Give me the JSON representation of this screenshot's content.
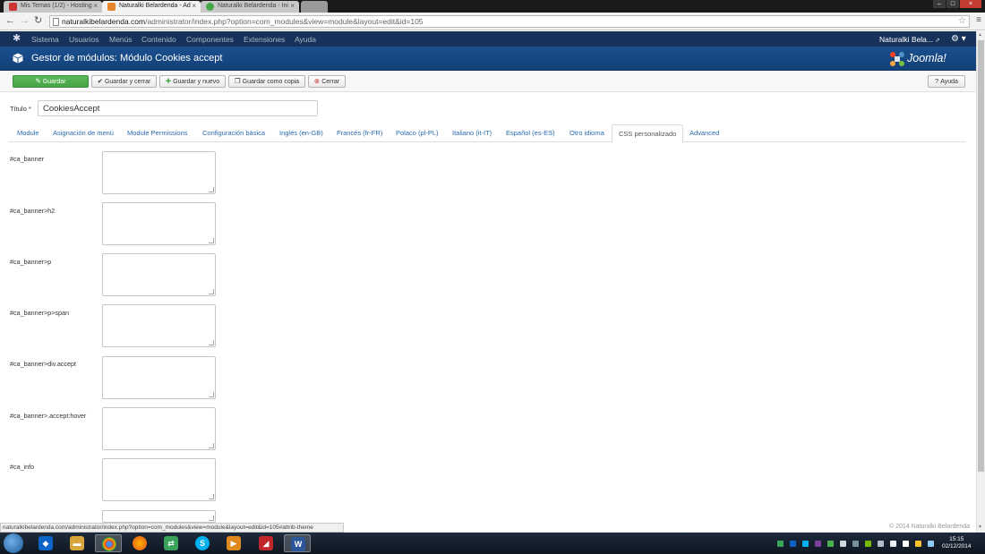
{
  "browser": {
    "tabs": [
      {
        "label": "Mis Temas (1/2) - Hosting",
        "active": false,
        "color": "#cc3333"
      },
      {
        "label": "Naturalki Belardenda - Ad",
        "active": true,
        "color": "#e8852b"
      },
      {
        "label": "Naturalki Belardenda - Ini",
        "active": false,
        "color": "#45a845"
      }
    ],
    "close_glyph": "×",
    "url_host": "naturalkibelardenda.com",
    "url_path": "/administrator/index.php?option=com_modules&view=module&layout=edit&id=105"
  },
  "topmenu": {
    "items": [
      "Sistema",
      "Usuarios",
      "Menús",
      "Contenido",
      "Componentes",
      "Extensiones",
      "Ayuda"
    ],
    "user": "Naturalki Bela...",
    "user_ext_glyph": "⇗",
    "gear_glyph": "⚙ ▾"
  },
  "header": {
    "title": "Gestor de módulos: Módulo Cookies accept",
    "brand": "Joomla!"
  },
  "toolbar": {
    "save": "Guardar",
    "save_close": "Guardar y cerrar",
    "save_new": "Guardar y nuevo",
    "save_copy": "Guardar como copia",
    "close": "Cerrar",
    "help": "Ayuda"
  },
  "form": {
    "title_label": "Título",
    "required_mark": "*",
    "title_value": "CookiesAccept",
    "tabs": [
      "Module",
      "Asignación de menú",
      "Module Permissions",
      "Configuración básica",
      "Inglés (en-GB)",
      "Francés (fr-FR)",
      "Polaco (pl-PL)",
      "Italiano (it-IT)",
      "Español (es-ES)",
      "Otro idioma",
      "CSS personalizado",
      "Advanced"
    ],
    "active_tab": "CSS personalizado",
    "fields": [
      "#ca_banner",
      "#ca_banner>h2",
      "#ca_banner>p",
      "#ca_banner>p>span",
      "#ca_banner>div.accept",
      "#ca_banner>.accept:hover",
      "#ca_info"
    ]
  },
  "statusbar": "naturalkibelardenda.com/administrator/index.php?option=com_modules&view=module&layout=edit&id=105#attrib-theme",
  "footer": "© 2014 Naturalki Belardenda",
  "clock": {
    "time": "15:15",
    "date": "02/12/2014"
  },
  "colors": {
    "joomla_navy": "#17325a",
    "header_blue": "#1a4f8e",
    "success_green": "#46a546",
    "link_blue": "#2a6ab0"
  }
}
